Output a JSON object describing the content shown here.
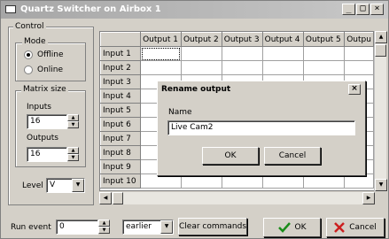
{
  "window": {
    "title": "Quartz Switcher on Airbox 1",
    "minimize_label": "_",
    "maximize_label": "□",
    "close_label": "×"
  },
  "control": {
    "group_label": "Control",
    "mode": {
      "label": "Mode",
      "options": [
        {
          "label": "Offline",
          "selected": true
        },
        {
          "label": "Online",
          "selected": false
        }
      ]
    },
    "matrix_size": {
      "label": "Matrix size",
      "inputs_label": "Inputs",
      "inputs_value": "16",
      "outputs_label": "Outputs",
      "outputs_value": "16"
    },
    "level_label": "Level",
    "level_value": "V"
  },
  "grid": {
    "columns": [
      "",
      "Output 1",
      "Output 2",
      "Output 3",
      "Output 4",
      "Output 5",
      "Outpu"
    ],
    "rows": [
      "Input 1",
      "Input 2",
      "Input 3",
      "Input 4",
      "Input 5",
      "Input 6",
      "Input 7",
      "Input 8",
      "Input 9",
      "Input 10"
    ]
  },
  "bottom": {
    "run_event_label": "Run event",
    "run_event_value": "0",
    "timing_value": "earlier",
    "clear_label": "Clear commands",
    "ok_label": "OK",
    "cancel_label": "Cancel"
  },
  "dialog": {
    "title": "Rename output",
    "close_label": "×",
    "name_label": "Name",
    "name_value": "Live Cam2",
    "ok_label": "OK",
    "cancel_label": "Cancel"
  },
  "colors": {
    "ok_check": "#1a8c1a",
    "cancel_x": "#cc2020"
  }
}
